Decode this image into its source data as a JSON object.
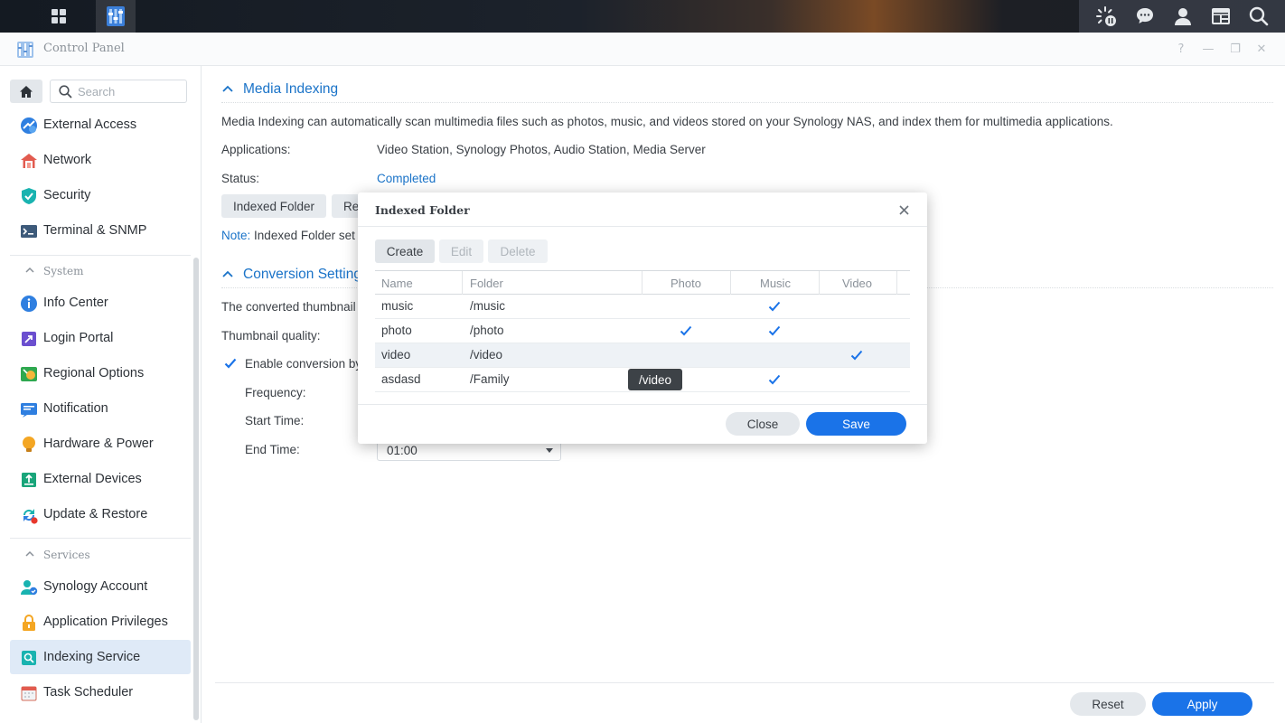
{
  "window": {
    "title": "Control Panel",
    "help": "?",
    "minimize": "—",
    "restore": "❐",
    "close": "✕"
  },
  "sidebar": {
    "search_placeholder": "Search",
    "top_items": [
      {
        "label": "External Access",
        "icon": "external-access-icon"
      },
      {
        "label": "Network",
        "icon": "network-icon"
      },
      {
        "label": "Security",
        "icon": "shield-icon"
      },
      {
        "label": "Terminal & SNMP",
        "icon": "terminal-icon"
      }
    ],
    "system_header": "System",
    "system_items": [
      {
        "label": "Info Center",
        "icon": "info-icon"
      },
      {
        "label": "Login Portal",
        "icon": "login-portal-icon"
      },
      {
        "label": "Regional Options",
        "icon": "globe-icon"
      },
      {
        "label": "Notification",
        "icon": "notification-icon"
      },
      {
        "label": "Hardware & Power",
        "icon": "lightbulb-icon"
      },
      {
        "label": "External Devices",
        "icon": "external-devices-icon"
      },
      {
        "label": "Update & Restore",
        "icon": "update-icon"
      }
    ],
    "services_header": "Services",
    "services_items": [
      {
        "label": "Synology Account",
        "icon": "account-icon"
      },
      {
        "label": "Application Privileges",
        "icon": "lock-icon"
      },
      {
        "label": "Indexing Service",
        "icon": "indexing-icon",
        "active": true
      },
      {
        "label": "Task Scheduler",
        "icon": "calendar-icon"
      }
    ]
  },
  "media": {
    "title": "Media Indexing",
    "description": "Media Indexing can automatically scan multimedia files such as photos, music, and videos stored on your Synology NAS, and index them for multimedia applications.",
    "applications_label": "Applications:",
    "applications_value": "Video Station, Synology Photos, Audio Station, Media Server",
    "status_label": "Status:",
    "status_value": "Completed",
    "indexed_folder_btn": "Indexed Folder",
    "reindex_btn_partial": "Re",
    "note_label": "Note:",
    "note_text": "Indexed Folder set"
  },
  "conversion": {
    "title": "Conversion Setting",
    "desc_partial": "The converted thumbnail",
    "thumbnail_quality_label": "Thumbnail quality:",
    "enable_label_partial": "Enable conversion by",
    "enable_checked": true,
    "frequency_label": "Frequency:",
    "start_label": "Start Time:",
    "end_label": "End Time:",
    "end_value": "01:00"
  },
  "footer": {
    "reset": "Reset",
    "apply": "Apply"
  },
  "dialog": {
    "title": "Indexed Folder",
    "create": "Create",
    "edit": "Edit",
    "delete": "Delete",
    "columns": {
      "name": "Name",
      "folder": "Folder",
      "photo": "Photo",
      "music": "Music",
      "video": "Video"
    },
    "rows": [
      {
        "name": "music",
        "folder": "/music",
        "photo": false,
        "music": true,
        "video": false
      },
      {
        "name": "photo",
        "folder": "/photo",
        "photo": true,
        "music": true,
        "video": false
      },
      {
        "name": "video",
        "folder": "/video",
        "photo": false,
        "music": false,
        "video": true,
        "selected": true
      },
      {
        "name": "asdasd",
        "folder": "/Family",
        "photo": false,
        "music": true,
        "video": false
      }
    ],
    "tooltip": "/video",
    "close": "Close",
    "save": "Save"
  },
  "colors": {
    "accent": "#1a73e8",
    "link": "#1a73c8",
    "check": "#1a73e8"
  }
}
